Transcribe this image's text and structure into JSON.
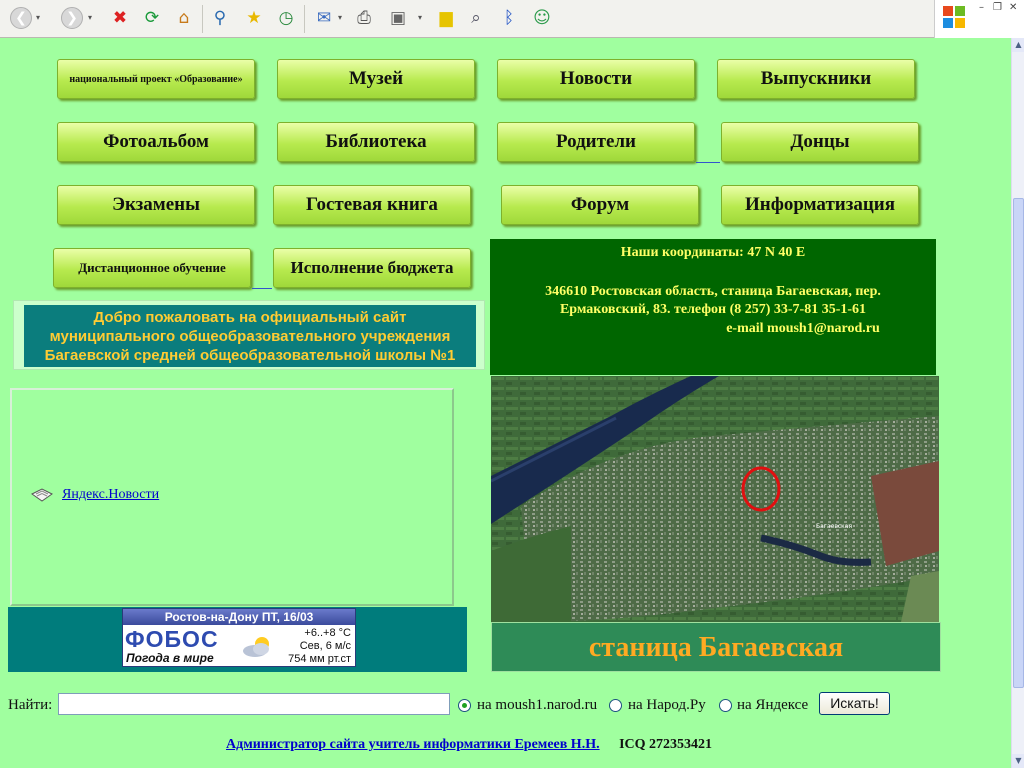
{
  "browser": {
    "toolbar_icons": [
      "back-icon",
      "forward-icon",
      "stop-icon",
      "refresh-icon",
      "home-icon",
      "search-icon",
      "favorites-icon",
      "history-icon",
      "mail-icon",
      "print-icon",
      "view-icon",
      "notes-icon",
      "research-icon",
      "bluetooth-icon",
      "messenger-icon"
    ]
  },
  "nav": {
    "row1": [
      "национальный проект «Образование»",
      "Музей",
      "Новости",
      "Выпускники"
    ],
    "row2": [
      "Фотоальбом",
      "Библиотека",
      "Родители",
      "Донцы"
    ],
    "row3": [
      "Экзамены",
      "Гостевая книга",
      "Форум",
      "Информатизация"
    ],
    "row4": [
      "Дистанционное обучение",
      "Исполнение бюджета"
    ]
  },
  "contacts": {
    "coords_line": "Наши координаты:  47 N 40 E",
    "address_line1": "346610 Ростовская область, станица Багаевская, пер.",
    "address_line2": "Ермаковский, 83.  телефон (8 257) 33-7-81  35-1-61",
    "email_line": "e-mail moush1@narod.ru"
  },
  "welcome": {
    "line1": "Добро пожаловать на официальный сайт",
    "line2": "муниципального общеобразовательного учреждения",
    "line3": "Багаевской средней общеобразовательной школы №1"
  },
  "news": {
    "link_label": "Яндекс.Новости"
  },
  "weather": {
    "city_date": "Ростов-на-Дону  ПТ, 16/03",
    "brand": "ФОБОС",
    "subtitle": "Погода в мире",
    "temp": "+6..+8 °C",
    "wind": "Сев, 6 м/с",
    "pressure": "754 мм рт.ст"
  },
  "map": {
    "caption": "станица Багаевская",
    "map_label": "Багаевская"
  },
  "search": {
    "label": "Найти:",
    "query_value": "",
    "options": [
      "на moush1.narod.ru",
      "на Народ.Ру",
      "на Яндексе"
    ],
    "selected_option": "на moush1.narod.ru",
    "submit_label": "Искать!"
  },
  "footer": {
    "admin_link": "Администратор сайта учитель информатики Еремеев Н.Н.",
    "icq": "ICQ 272353421"
  },
  "colors": {
    "page_bg": "#a0ff9f",
    "contacts_bg": "#006600",
    "contacts_text": "#ffff66",
    "welcome_bg": "#0b7d7d",
    "welcome_text": "#ffcc33",
    "caption_text": "#ffaa22"
  }
}
